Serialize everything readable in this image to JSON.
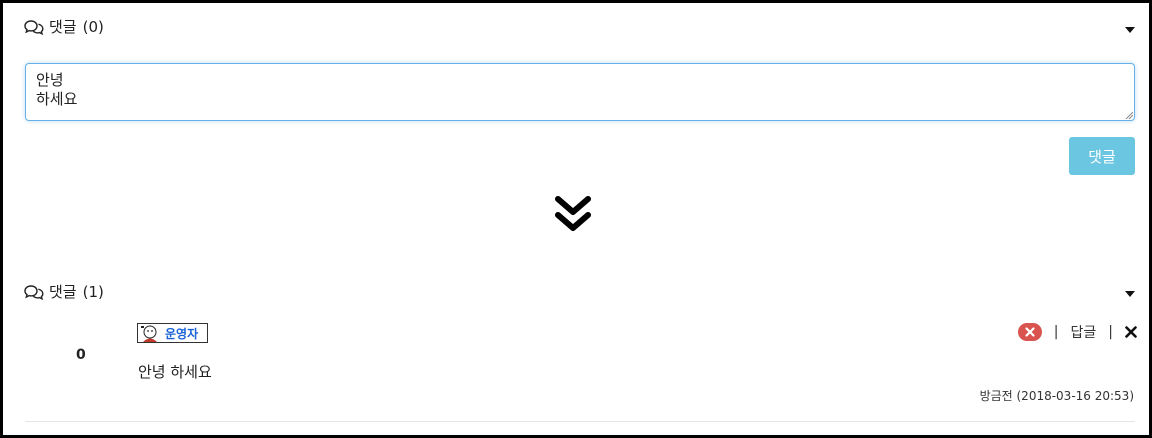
{
  "before": {
    "section_title": "댓글",
    "count": "(0)",
    "textarea_value": "안녕\n하세요",
    "submit_label": "댓글"
  },
  "after": {
    "section_title": "댓글",
    "count": "(1)",
    "comment": {
      "score": "0",
      "author": "운영자",
      "text": "안녕 하세요",
      "reply_label": "답글",
      "separator": "|",
      "timestamp": "방금전 (2018-03-16 20:53)"
    }
  },
  "icons": {
    "comments": "comments-icon",
    "collapse": "caret-down-icon",
    "transition": "double-chevron-down-icon",
    "report": "report-icon",
    "delete": "close-icon",
    "avatar": "avatar-icon"
  },
  "colors": {
    "accent_border": "#66afe9",
    "submit_bg": "#5bc0de",
    "report_bg": "#d9534f",
    "author": "#1a62d6"
  }
}
